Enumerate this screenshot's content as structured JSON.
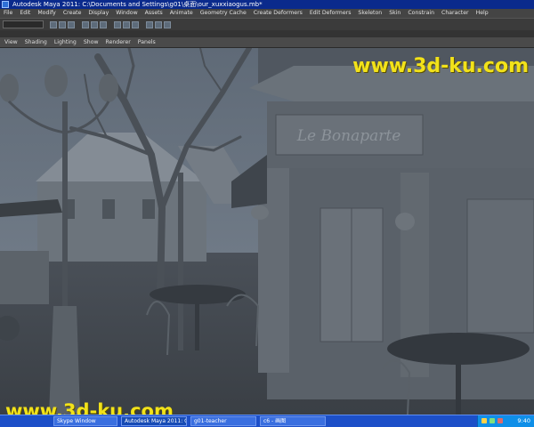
{
  "window": {
    "title": "Autodesk Maya 2011: C:\\Documents and Settings\\g01\\桌面\\our_xuxxiaogus.mb*"
  },
  "menubar": [
    "File",
    "Edit",
    "Modify",
    "Create",
    "Display",
    "Window",
    "Assets",
    "Animate",
    "Geometry Cache",
    "Create Deformers",
    "Edit Deformers",
    "Skeleton",
    "Skin",
    "Constrain",
    "Character",
    "Help"
  ],
  "panel_menu": [
    "View",
    "Shading",
    "Lighting",
    "Show",
    "Renderer",
    "Panels"
  ],
  "scene": {
    "shop_sign": "Le Bonaparte"
  },
  "watermark": {
    "text": "www.3d-ku.com"
  },
  "taskbar": {
    "tasks": [
      "Skype Window",
      "Autodesk Maya 2011: C...",
      "g01-teacher",
      "c6 - 画图"
    ],
    "clock": "9:40"
  },
  "colors": {
    "taskbar": "#1c4fc8",
    "titlebar": "#0a2a8c",
    "watermark": "#f2e21a"
  }
}
